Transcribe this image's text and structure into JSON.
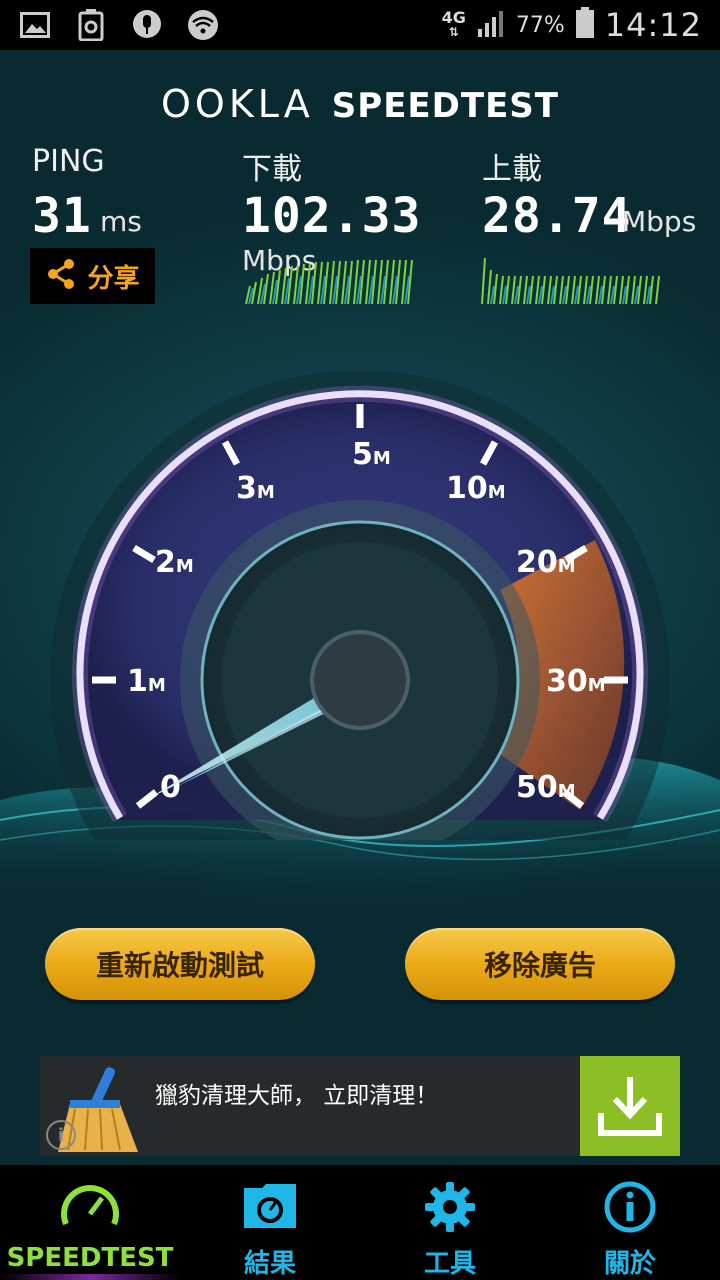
{
  "status_bar": {
    "network": "4G",
    "battery": "77%",
    "time": "14:12",
    "icons": [
      "image-icon",
      "recycle-icon",
      "microphone-icon",
      "wifi-icon",
      "signal-icon",
      "battery-icon"
    ]
  },
  "header": {
    "brand_ookla": "OOKLA",
    "brand_speedtest": "SPEEDTEST"
  },
  "stats": {
    "ping": {
      "label": "PING",
      "value": "31",
      "unit": "ms"
    },
    "download": {
      "label": "下載",
      "value": "102.33",
      "unit": "Mbps"
    },
    "upload": {
      "label": "上載",
      "value": "28.74",
      "unit": "Mbps"
    }
  },
  "share": {
    "label": "分享"
  },
  "gauge": {
    "scale_labels": [
      {
        "num": "0",
        "unit": ""
      },
      {
        "num": "1",
        "unit": "M"
      },
      {
        "num": "2",
        "unit": "M"
      },
      {
        "num": "3",
        "unit": "M"
      },
      {
        "num": "5",
        "unit": "M"
      },
      {
        "num": "10",
        "unit": "M"
      },
      {
        "num": "20",
        "unit": "M"
      },
      {
        "num": "30",
        "unit": "M"
      },
      {
        "num": "50",
        "unit": "M"
      }
    ],
    "accent_purple": "#b07cf0",
    "accent_orange": "#f39a3a"
  },
  "buttons": {
    "restart": "重新啟動測試",
    "remove_ads": "移除廣告"
  },
  "ad": {
    "text": "獵豹清理大師， 立即清理！",
    "info_glyph": "i"
  },
  "nav": {
    "items": [
      {
        "label": "SPEEDTEST",
        "icon": "speedometer-icon",
        "active": true
      },
      {
        "label": "結果",
        "icon": "results-folder-icon",
        "active": false
      },
      {
        "label": "工具",
        "icon": "gear-icon",
        "active": false
      },
      {
        "label": "關於",
        "icon": "info-icon",
        "active": false
      }
    ]
  },
  "colors": {
    "nav_active": "#8fe03a",
    "nav_inactive": "#1fb6e8",
    "button_gold": "#e9a814",
    "share_orange": "#f4a51c",
    "ad_download_green": "#8cbf26"
  }
}
